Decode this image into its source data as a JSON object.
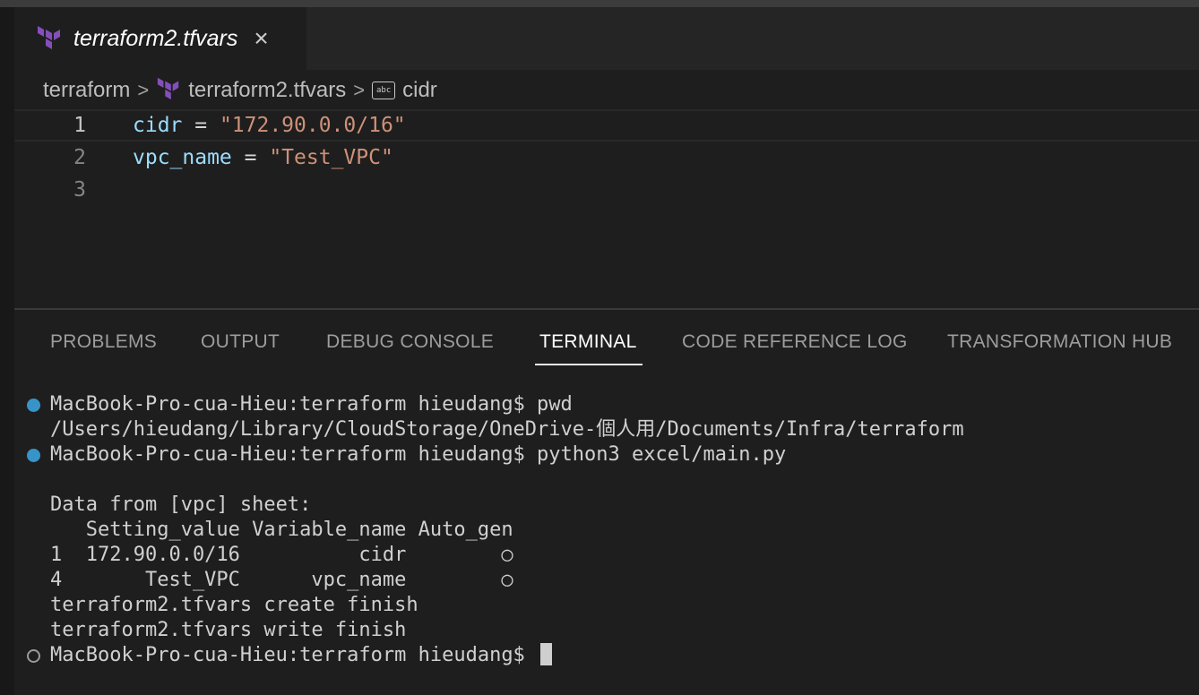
{
  "tab": {
    "title": "terraform2.tfvars",
    "close_glyph": "×",
    "icon": "terraform-icon",
    "icon_color": "#844fba"
  },
  "breadcrumb": {
    "folder": "terraform",
    "file": "terraform2.tfvars",
    "symbol": "cidr",
    "symbol_icon": "string-abc-icon",
    "separator": ">"
  },
  "editor": {
    "lines": [
      {
        "number": "1",
        "var": "cidr",
        "op": " = ",
        "value": "\"172.90.0.0/16\""
      },
      {
        "number": "2",
        "var": "vpc_name",
        "op": " = ",
        "value": "\"Test_VPC\""
      },
      {
        "number": "3",
        "var": "",
        "op": "",
        "value": ""
      }
    ]
  },
  "panel": {
    "tabs": [
      {
        "label": "PROBLEMS"
      },
      {
        "label": "OUTPUT"
      },
      {
        "label": "DEBUG CONSOLE"
      },
      {
        "label": "TERMINAL"
      },
      {
        "label": "CODE REFERENCE LOG"
      },
      {
        "label": "TRANSFORMATION HUB"
      }
    ],
    "active_tab": "TERMINAL"
  },
  "terminal": {
    "lines": [
      {
        "text": "MacBook-Pro-cua-Hieu:terraform hieudang$ pwd",
        "marker": "blue"
      },
      {
        "text": "/Users/hieudang/Library/CloudStorage/OneDrive-個人用/Documents/Infra/terraform",
        "marker": "none"
      },
      {
        "text": "MacBook-Pro-cua-Hieu:terraform hieudang$ python3 excel/main.py",
        "marker": "blue"
      },
      {
        "text": "",
        "marker": "none"
      },
      {
        "text": "Data from [vpc] sheet:",
        "marker": "none"
      },
      {
        "text": "   Setting_value Variable_name Auto_gen",
        "marker": "none"
      },
      {
        "text": "1  172.90.0.0/16          cidr        ○",
        "marker": "none"
      },
      {
        "text": "4       Test_VPC      vpc_name        ○",
        "marker": "none"
      },
      {
        "text": "terraform2.tfvars create finish",
        "marker": "none"
      },
      {
        "text": "terraform2.tfvars write finish",
        "marker": "none"
      },
      {
        "text": "MacBook-Pro-cua-Hieu:terraform hieudang$ ",
        "marker": "hollow"
      }
    ]
  },
  "colors": {
    "background": "#1e1e1e",
    "variable": "#9cdcfe",
    "string": "#ce9178",
    "prompt_marker": "#3794c9"
  }
}
